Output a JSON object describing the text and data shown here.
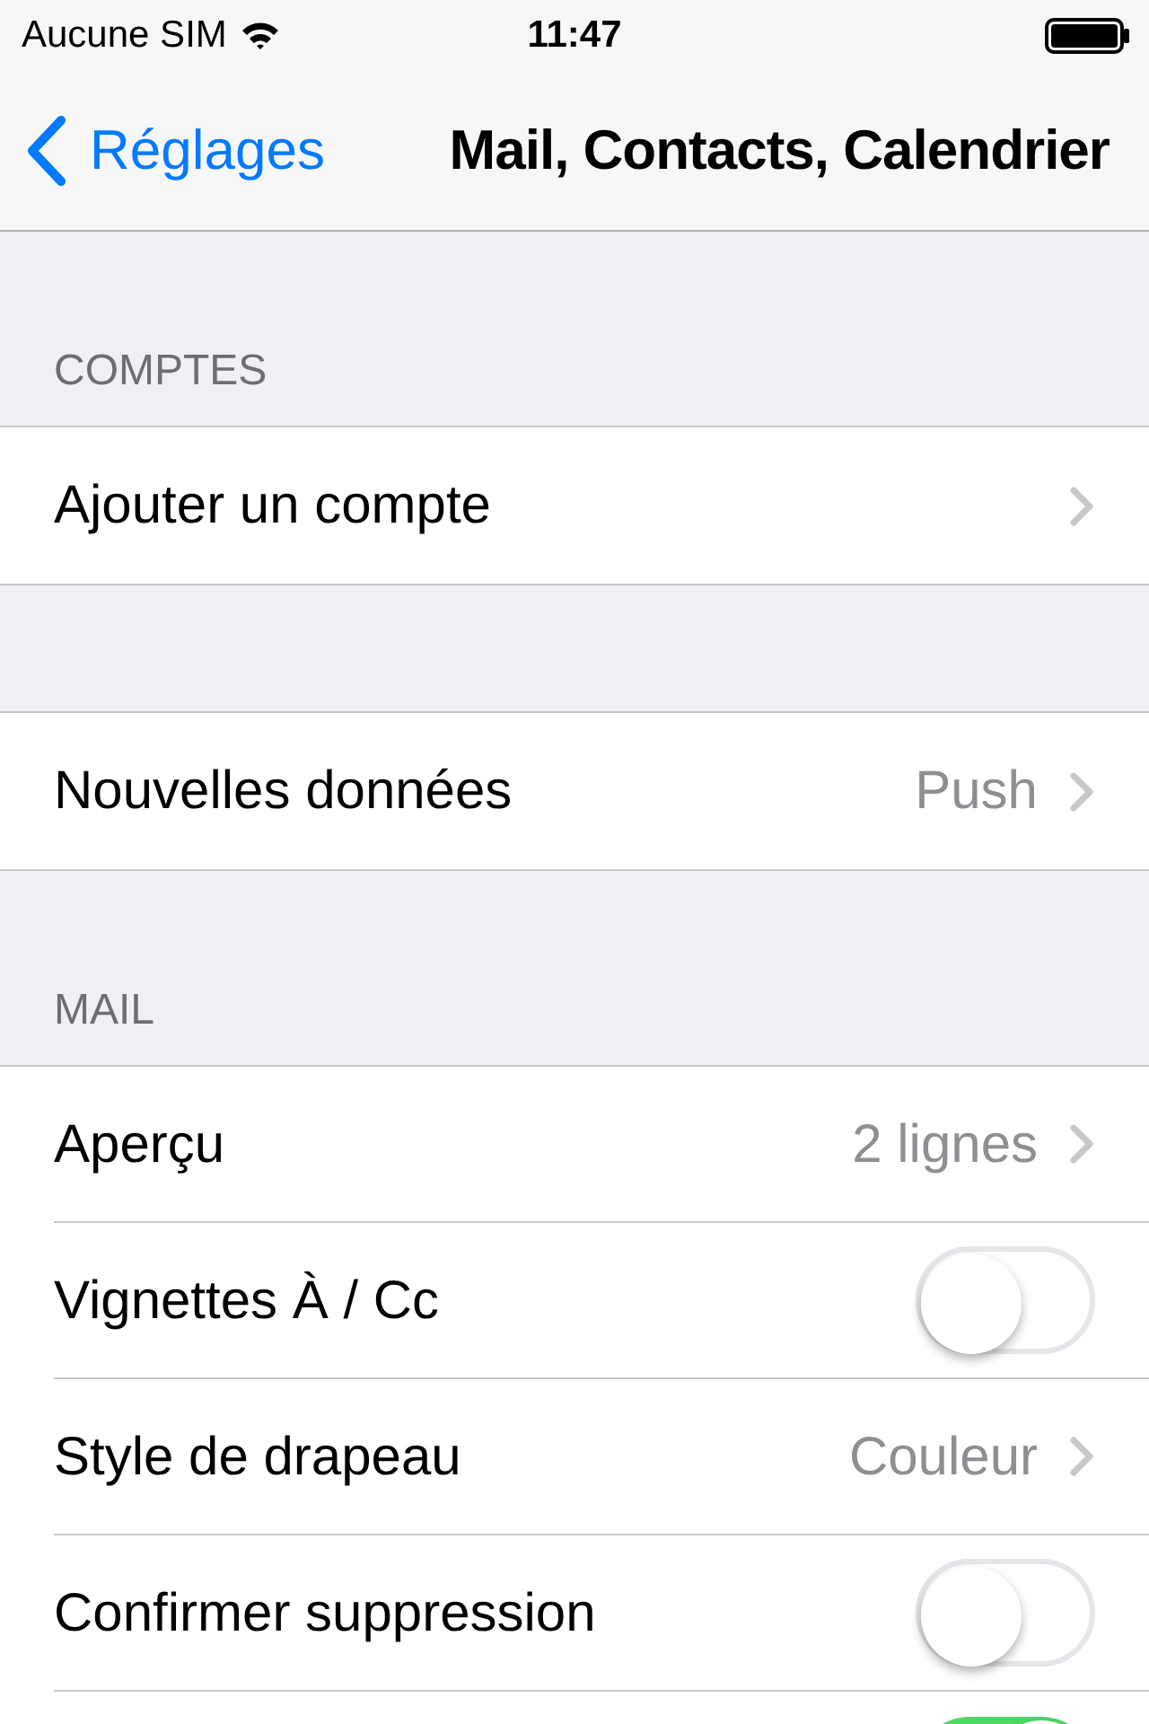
{
  "status_bar": {
    "carrier": "Aucune SIM",
    "time": "11:47"
  },
  "nav": {
    "back": "Réglages",
    "title": "Mail, Contacts, Calendrier"
  },
  "sections": [
    {
      "header": "COMPTES",
      "rows": [
        {
          "kind": "link",
          "label": "Ajouter un compte"
        }
      ]
    },
    {
      "rows": [
        {
          "kind": "link",
          "label": "Nouvelles données",
          "value": "Push"
        }
      ]
    },
    {
      "header": "MAIL",
      "rows": [
        {
          "kind": "link",
          "label": "Aperçu",
          "value": "2 lignes"
        },
        {
          "kind": "toggle",
          "label": "Vignettes À / Cc",
          "on": false
        },
        {
          "kind": "link",
          "label": "Style de drapeau",
          "value": "Couleur"
        },
        {
          "kind": "toggle",
          "label": "Confirmer suppression",
          "on": false
        },
        {
          "kind": "toggle",
          "on": true
        }
      ]
    }
  ]
}
